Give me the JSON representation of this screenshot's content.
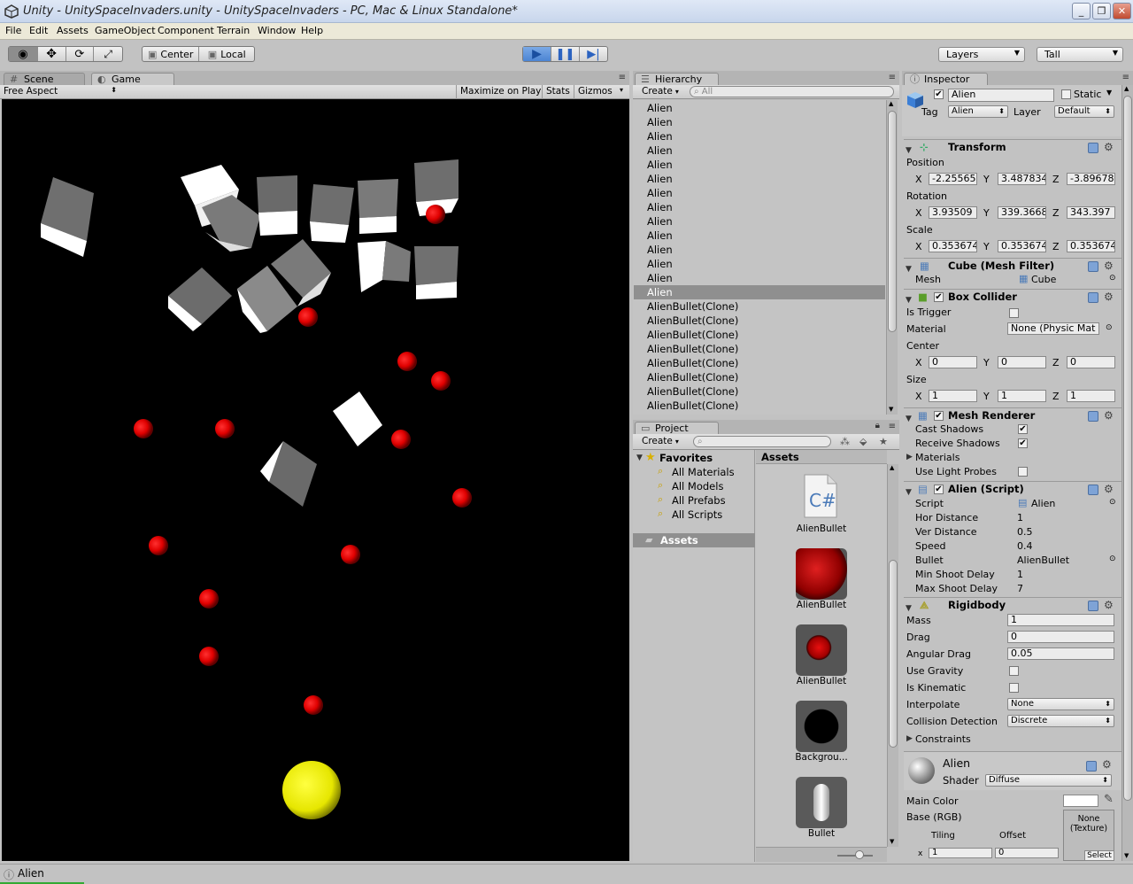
{
  "window": {
    "title": "Unity - UnitySpaceInvaders.unity - UnitySpaceInvaders - PC, Mac & Linux Standalone*"
  },
  "menu": [
    "File",
    "Edit",
    "Assets",
    "GameObject",
    "Component",
    "Terrain",
    "Window",
    "Help"
  ],
  "toolbar": {
    "pivot": "Center",
    "space": "Local",
    "layers": "Layers",
    "layout": "Tall"
  },
  "game_panel": {
    "tabs": [
      "Scene",
      "Game"
    ],
    "aspect": "Free Aspect",
    "maximize": "Maximize on Play",
    "stats": "Stats",
    "gizmos": "Gizmos"
  },
  "hierarchy": {
    "tab": "Hierarchy",
    "create": "Create",
    "search_placeholder": "All",
    "items": [
      "Alien",
      "Alien",
      "Alien",
      "Alien",
      "Alien",
      "Alien",
      "Alien",
      "Alien",
      "Alien",
      "Alien",
      "Alien",
      "Alien",
      "Alien",
      "Alien",
      "AlienBullet(Clone)",
      "AlienBullet(Clone)",
      "AlienBullet(Clone)",
      "AlienBullet(Clone)",
      "AlienBullet(Clone)",
      "AlienBullet(Clone)",
      "AlienBullet(Clone)",
      "AlienBullet(Clone)"
    ],
    "selected_index": 13
  },
  "project": {
    "tab": "Project",
    "create": "Create",
    "favorites_label": "Favorites",
    "favorites": [
      "All Materials",
      "All Models",
      "All Prefabs",
      "All Scripts"
    ],
    "assets_folder": "Assets",
    "assets_header": "Assets",
    "assets": [
      "AlienBullet",
      "AlienBullet",
      "AlienBullet",
      "Backgrou...",
      "Bullet"
    ]
  },
  "inspector": {
    "tab": "Inspector",
    "name": "Alien",
    "static_label": "Static",
    "tag_label": "Tag",
    "tag": "Alien",
    "layer_label": "Layer",
    "layer": "Default",
    "transform": {
      "title": "Transform",
      "position_label": "Position",
      "position": [
        "-2.25565",
        "3.487834",
        "-3.89678"
      ],
      "rotation_label": "Rotation",
      "rotation": [
        "3.93509",
        "339.3668",
        "343.397"
      ],
      "scale_label": "Scale",
      "scale": [
        "0.353674",
        "0.353674",
        "0.353674"
      ]
    },
    "mesh_filter": {
      "title": "Cube (Mesh Filter)",
      "mesh_label": "Mesh",
      "mesh": "Cube"
    },
    "box_collider": {
      "title": "Box Collider",
      "trigger_label": "Is Trigger",
      "material_label": "Material",
      "material": "None (Physic Mat",
      "center_label": "Center",
      "center": [
        "0",
        "0",
        "0"
      ],
      "size_label": "Size",
      "size": [
        "1",
        "1",
        "1"
      ]
    },
    "mesh_renderer": {
      "title": "Mesh Renderer",
      "cast_label": "Cast Shadows",
      "receive_label": "Receive Shadows",
      "materials_label": "Materials",
      "probes_label": "Use Light Probes"
    },
    "alien_script": {
      "title": "Alien (Script)",
      "rows": [
        {
          "label": "Script",
          "value": "Alien"
        },
        {
          "label": "Hor Distance",
          "value": "1"
        },
        {
          "label": "Ver Distance",
          "value": "0.5"
        },
        {
          "label": "Speed",
          "value": "0.4"
        },
        {
          "label": "Bullet",
          "value": "AlienBullet"
        },
        {
          "label": "Min Shoot Delay",
          "value": "1"
        },
        {
          "label": "Max Shoot Delay",
          "value": "7"
        }
      ]
    },
    "rigidbody": {
      "title": "Rigidbody",
      "mass_label": "Mass",
      "mass": "1",
      "drag_label": "Drag",
      "drag": "0",
      "angular_label": "Angular Drag",
      "angular": "0.05",
      "gravity_label": "Use Gravity",
      "kinematic_label": "Is Kinematic",
      "interp_label": "Interpolate",
      "interp": "None",
      "collision_label": "Collision Detection",
      "collision": "Discrete",
      "constraints_label": "Constraints"
    },
    "material": {
      "name": "Alien",
      "shader_label": "Shader",
      "shader": "Diffuse",
      "main_color_label": "Main Color",
      "base_label": "Base (RGB)",
      "tiling_label": "Tiling",
      "offset_label": "Offset",
      "texture": "None (Texture)",
      "select": "Select",
      "tiling_x": "1",
      "offset_x": "0"
    }
  },
  "status": {
    "text": "Alien"
  },
  "colors": {
    "accent": "#3c7fd6",
    "bullet": "#e00000",
    "player": "#ffff00"
  }
}
